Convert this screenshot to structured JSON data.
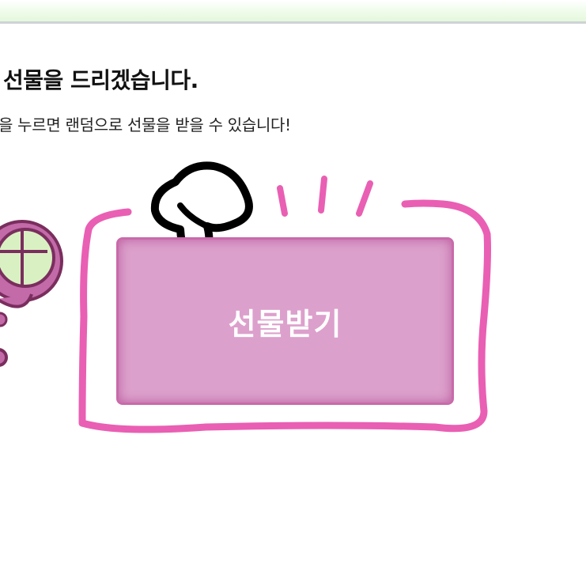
{
  "header": {
    "title": "선물을 드리겠습니다.",
    "subtitle": "을 누르면 랜덤으로 선물을 받을 수 있습니다!"
  },
  "gift_button": {
    "label": "선물받기"
  },
  "colors": {
    "accent_pink": "#e95fb3",
    "button_fill": "#dca0cc",
    "button_border": "#c96aaa",
    "header_strip": "#e4f7dc"
  },
  "icons": {
    "pointer": "pointing-hand-icon",
    "character": "mascot-character-icon"
  }
}
